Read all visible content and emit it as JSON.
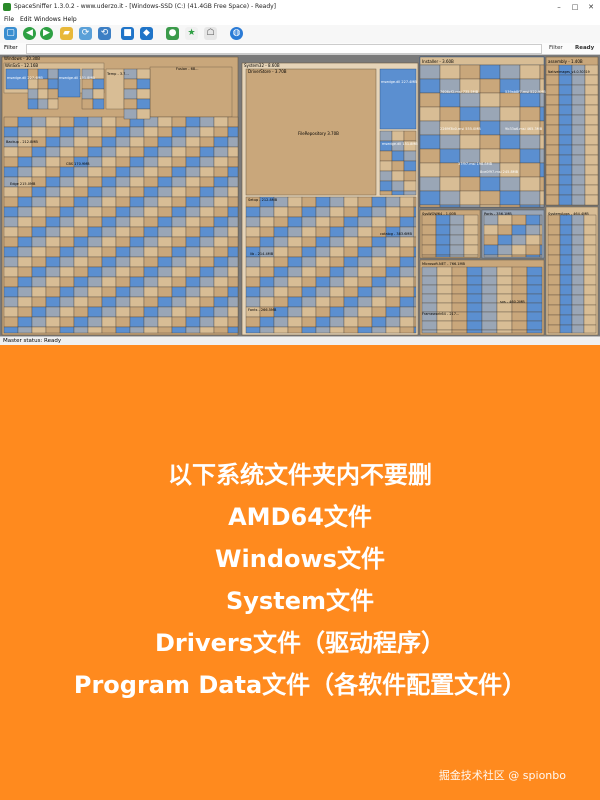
{
  "window": {
    "title": "SpaceSniffer 1.3.0.2 - www.uderzo.it - [Windows-SSD (C:) (41.4GB Free Space) - Ready]",
    "menu": [
      "File",
      "Edit",
      "Windows",
      "Help"
    ],
    "filter_label": "Filter",
    "filter_button": "Filter",
    "ready_label": "Ready",
    "status": "Master status: Ready"
  },
  "toolbar_icons": [
    "new-window-icon",
    "back-icon",
    "forward-icon",
    "open-folder-icon",
    "refresh-icon",
    "reload-icon",
    "cube-icon",
    "shield-icon",
    "users-icon",
    "star-icon",
    "ghost-icon",
    "globe-icon"
  ],
  "treemap": {
    "root_label": "Windows - 30.30B",
    "winsxs_label": "WinSxS - 12.16B",
    "temp_label": "Temp - 3.7...",
    "fusion_label": "Fusion - 68...",
    "system32_label": "System32 - 8.60B",
    "driverstore_label": "DriverStore - 3.70B",
    "filerepository_label": "FileRepository 3.70B",
    "installer_label": "Installer - 3.60B",
    "assembly_label": "assembly - 1.40B",
    "native_images_label": "NativeImages_v4.0.30319",
    "msedge_label_1": "msedge.dll 227.4MB",
    "msedge_label_2": "msedge.dll 151.8MB",
    "msedge_label_3": "msedge.dll 151.8MB",
    "msedge_label_4": "msedge.dll 227.4MB",
    "backup_label": "Backup - 212.8MB",
    "syswow64_label": "SysWOW64 - 1.00B",
    "microsoft_net_label": "Microsoft.NET - 766.1MB",
    "ports_label": "Ports - 356.1MB",
    "system_apps_label": "SystemApps - 464.4MB",
    "sxs_label": "sxs - 460.2MB",
    "catalog_label": "catalog - 383.6MB",
    "fonts_label": "Fonts - 266.5MB",
    "setup_label": "Setup - 212.8MB",
    "lib_label": "lib - 214.4MB",
    "framework64_label": "Framework64 - 217...",
    "msp_1": "7606cf2.msi 735.5MB",
    "msp_2": "539ab8f7.msi 522.9MB",
    "msp_3": "2269f3b0.msi 555.0MB",
    "msp_4": "9b33a6.msi 465.3MB",
    "msp_5": "8ce0f97.msi 245.8MB",
    "msp_6": "37f97.msi 198.8MB",
    "cbs_label": "CBS 170.9MB",
    "edge_label": "Edge 215.0MB"
  },
  "caption": {
    "heading": "以下系统文件夹内不要删",
    "items": [
      "AMD64文件",
      "Windows文件",
      "System文件",
      "Drivers文件（驱动程序）",
      "Program Data文件（各软件配置文件）"
    ]
  },
  "watermark": "掘金技术社区 @ spionbo",
  "colors": {
    "orange_bg": "#ff8a1e",
    "treemap_tan": "#c9a77b",
    "treemap_blue": "#5b8fd0",
    "treemap_gray": "#9aa6b6",
    "treemap_tan_light": "#d8bd95"
  }
}
